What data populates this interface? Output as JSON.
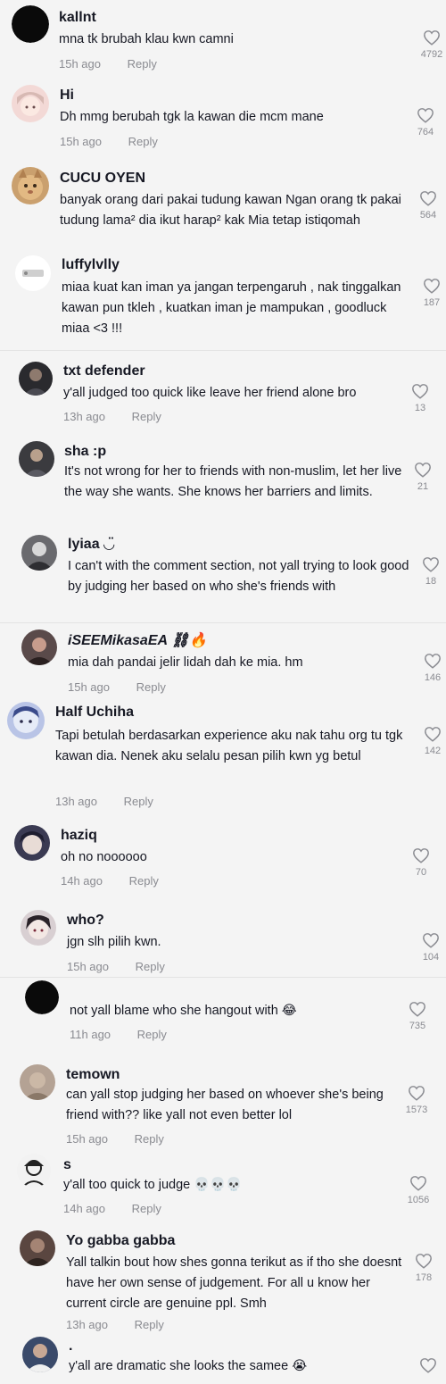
{
  "reply_label": "Reply",
  "comments": [
    {
      "username": "kallnt",
      "text": "mna tk brubah klau kwn camni",
      "time": "15h ago",
      "likes": "4792",
      "avatar_icon": "black-circle-avatar"
    },
    {
      "username": "Hi",
      "text": "Dh mmg berubah tgk la kawan die mcm mane",
      "time": "15h ago",
      "likes": "764",
      "avatar_icon": "anime-girl-avatar"
    },
    {
      "username": "CUCU OYEN",
      "text": "banyak orang dari pakai tudung kawan Ngan orang tk pakai tudung lama² dia ikut harap² kak Mia tetap istiqomah",
      "time": "",
      "likes": "564",
      "avatar_icon": "orange-cat-avatar"
    },
    {
      "username": "luffylvlly",
      "text": "miaa kuat kan iman ya jangan terpengaruh , nak tinggalkan kawan pun tkleh , kuatkan iman je mampukan , goodluck miaa <3 !!!",
      "time": "",
      "likes": "187",
      "avatar_icon": "logo-avatar"
    },
    {
      "username": "txt defender",
      "text": "y'all judged too quick like leave her friend alone bro",
      "time": "13h ago",
      "likes": "13",
      "avatar_icon": "person-avatar"
    },
    {
      "username": "sha :p",
      "text": "It's not wrong for her to friends with non-muslim, let her live the way she wants. She knows her barriers and limits.",
      "time": "",
      "likes": "21",
      "avatar_icon": "person-avatar"
    },
    {
      "username": "lyiaa ◡̈",
      "text": "I can't with the comment section, not yall trying to look good by judging her based on who she's friends with",
      "time": "",
      "likes": "18",
      "avatar_icon": "person-avatar"
    },
    {
      "username": "iSEEMikasaEA ⛓🔥",
      "text": "mia dah pandai jelir lidah dah ke mia. hm",
      "time": "15h ago",
      "likes": "146",
      "avatar_icon": "person-avatar"
    },
    {
      "username": "Half Uchiha",
      "text": "Tapi betulah berdasarkan experience aku nak tahu org tu tgk kawan dia. Nenek aku selalu pesan pilih kwn yg betul",
      "time": "13h ago",
      "likes": "142",
      "avatar_icon": "anime-avatar"
    },
    {
      "username": "haziq",
      "text": "oh no noooooo",
      "time": "14h ago",
      "likes": "70",
      "avatar_icon": "anime-avatar"
    },
    {
      "username": "who?",
      "text": "jgn slh pilih kwn.",
      "time": "15h ago",
      "likes": "104",
      "avatar_icon": "anime-avatar"
    },
    {
      "username": "",
      "text": "not yall blame who she hangout with 😂",
      "time": "11h ago",
      "likes": "735",
      "avatar_icon": "black-circle-avatar"
    },
    {
      "username": "temown",
      "text": "can yall stop judging her based on whoever she's being friend with?? like yall not even better lol",
      "time": "15h ago",
      "likes": "1573",
      "avatar_icon": "blurred-avatar"
    },
    {
      "username": "s",
      "text": "y'all too quick to judge 💀💀💀",
      "time": "14h ago",
      "likes": "1056",
      "avatar_icon": "sketch-avatar"
    },
    {
      "username": "Yo gabba gabba",
      "text": "Yall talkin bout how shes gonna terikut as if tho she doesnt have her own sense of judgement. For all u know her current circle are genuine ppl. Smh",
      "time": "13h ago",
      "likes": "178",
      "avatar_icon": "person-avatar"
    },
    {
      "username": ".",
      "text": "y'all are dramatic she looks the samee 😭",
      "time": "",
      "likes": "",
      "avatar_icon": "person-avatar"
    }
  ]
}
